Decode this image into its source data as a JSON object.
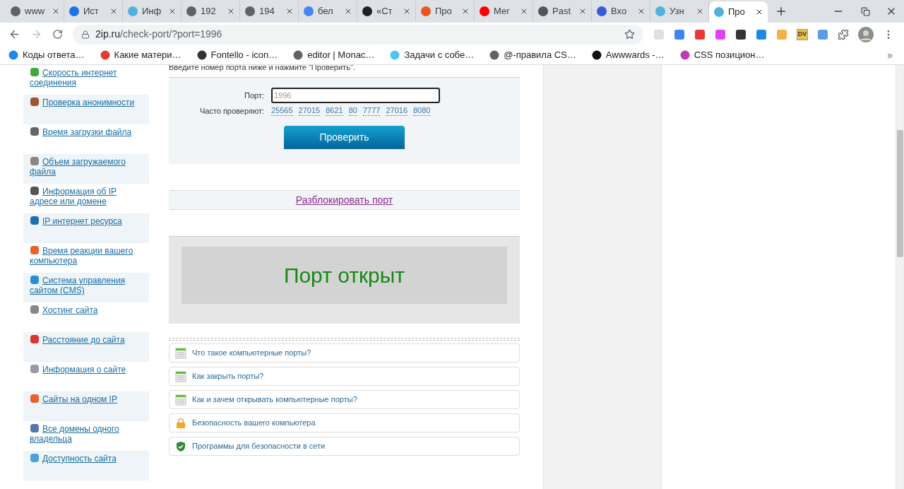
{
  "browser": {
    "tabs": [
      {
        "title": "www",
        "selected": false
      },
      {
        "title": "Ист",
        "selected": false
      },
      {
        "title": "Инф",
        "selected": false
      },
      {
        "title": "192",
        "selected": false
      },
      {
        "title": "194",
        "selected": false
      },
      {
        "title": "бел",
        "selected": false
      },
      {
        "title": "«Ст",
        "selected": false
      },
      {
        "title": "Про",
        "selected": false
      },
      {
        "title": "Мег",
        "selected": false
      },
      {
        "title": "Past",
        "selected": false
      },
      {
        "title": "Вхо",
        "selected": false
      },
      {
        "title": "Узн",
        "selected": false
      },
      {
        "title": "Про",
        "selected": true
      }
    ],
    "address": {
      "host": "2ip.ru",
      "path": "/check-port/?port=1996"
    },
    "extension_badge": "DV",
    "bookmarks": [
      "Коды ответа…",
      "Какие матери…",
      "Fontello - icon…",
      "editor | Monac…",
      "Задачи с собе…",
      "@-правила CS…",
      "Awwwards -…",
      "CSS позицион…"
    ],
    "more_bookmarks": "»"
  },
  "sidebar": [
    {
      "label": "Скорость интернет соединения"
    },
    {
      "label": "Проверка анонимности"
    },
    {
      "label": "Время загрузки файла"
    },
    {
      "label": "Объем загружаемого файла"
    },
    {
      "label": "Информация об IP адресе или домене"
    },
    {
      "label": "IP интернет ресурса"
    },
    {
      "label": "Время реакции вашего компьютера"
    },
    {
      "label": "Система управления сайтом (CMS)"
    },
    {
      "label": "Хостинг сайта"
    },
    {
      "label": "Расстояние до сайта"
    },
    {
      "label": "Информация о сайте"
    },
    {
      "label": "Сайты на одном IP"
    },
    {
      "label": "Все домены одного владельца"
    },
    {
      "label": "Доступность сайта"
    }
  ],
  "intro": "Введите номер порта ниже и нажмите \"Проверить\".",
  "port_label": "Порт:",
  "port_field": {
    "placeholder": "1996"
  },
  "frequent_label": "Часто проверяют:",
  "frequent_ports": [
    "25565",
    "27015",
    "8621",
    "80",
    "7777",
    "27016",
    "8080"
  ],
  "check_button": "Проверить",
  "unblock_link": "Разблокировать порт",
  "result": "Порт открыт",
  "articles": [
    {
      "title": "Что такое компьютерные порты?",
      "kind": "page"
    },
    {
      "title": "Как закрыть порты?",
      "kind": "page"
    },
    {
      "title": "Как и зачем открывать компьютерные порты?",
      "kind": "page"
    },
    {
      "title": "Безопасность вашего компьютера",
      "kind": "lock"
    },
    {
      "title": "Программы для безопасности в сети",
      "kind": "shield"
    }
  ]
}
